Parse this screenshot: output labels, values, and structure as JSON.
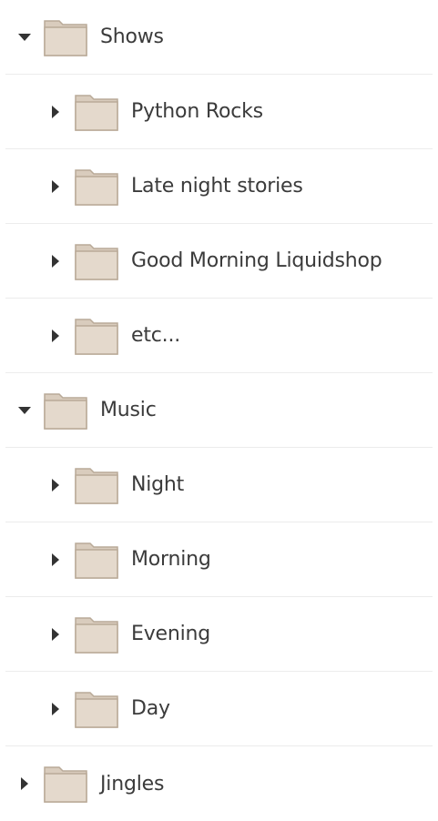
{
  "tree": {
    "shows": {
      "label": "Shows",
      "children": [
        "Python Rocks",
        "Late night stories",
        "Good Morning Liquidshop",
        "etc..."
      ]
    },
    "music": {
      "label": "Music",
      "children": [
        "Night",
        "Morning",
        "Evening",
        "Day"
      ]
    },
    "jingles": {
      "label": "Jingles"
    }
  },
  "icons": {
    "expanded": "triangle-down",
    "collapsed": "triangle-right",
    "folder": "folder-icon"
  },
  "colors": {
    "folder_fill": "#e4d9cc",
    "folder_tab": "#d9ccbd",
    "folder_stroke": "#b9aa98",
    "arrow": "#333333",
    "separator": "#ececec"
  }
}
